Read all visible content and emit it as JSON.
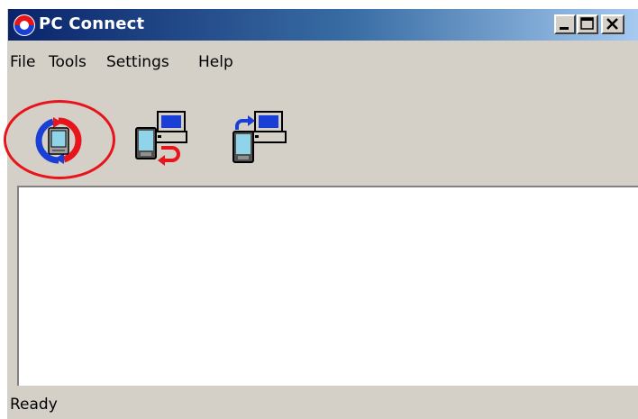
{
  "window": {
    "title": "PC Connect"
  },
  "menu": [
    "File",
    "Tools",
    "Settings",
    "Help"
  ],
  "toolbar": {
    "tools": [
      {
        "icon": "sync-icon"
      },
      {
        "icon": "device-to-pc-icon"
      },
      {
        "icon": "pc-to-device-icon"
      }
    ],
    "highlight_color": "#e8141b"
  },
  "status": {
    "text": "Ready"
  },
  "colors": {
    "titlebar_start": "#0a246a",
    "titlebar_end": "#a6caf0",
    "chrome": "#d4d0c8"
  }
}
